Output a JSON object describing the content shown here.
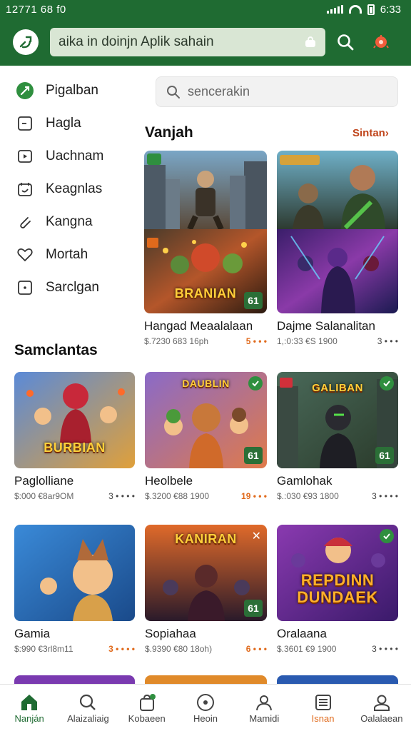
{
  "status": {
    "time": "12771 68 f0",
    "clock": "6:33"
  },
  "appbar": {
    "search_text": "aika in doinjn Aplik sahain"
  },
  "sidebar": {
    "items": [
      {
        "label": "Pigalban",
        "icon": "compass-icon"
      },
      {
        "label": "Hagla",
        "icon": "square-icon"
      },
      {
        "label": "Uachnam",
        "icon": "video-icon"
      },
      {
        "label": "Keagnlas",
        "icon": "calendar-icon"
      },
      {
        "label": "Kangna",
        "icon": "paperclip-icon"
      },
      {
        "label": "Mortah",
        "icon": "heart-icon"
      },
      {
        "label": "Sarclgan",
        "icon": "dot-square-icon"
      }
    ]
  },
  "content_search": {
    "placeholder": "sencerakin"
  },
  "featured": {
    "title": "Vanjah",
    "link": "Sintan›",
    "cards": [
      {
        "name": "Hangad Meaalalaan",
        "meta": "$.7230 683 16ph",
        "rating": "5 • • •",
        "badge": "61",
        "art_title": "BRANIAN"
      },
      {
        "name": "Dajme Salanalitan",
        "meta": "1,:0:33 €S 1900",
        "rating": "3 • • •",
        "badge": "",
        "art_title": ""
      }
    ]
  },
  "section2": {
    "title": "Samclantas",
    "cards": [
      {
        "name": "Paglolliane",
        "meta": "$:000 €8ar9OM",
        "rating": "3 • • • •",
        "badge": "",
        "art_title": "BURBIAN"
      },
      {
        "name": "Heolbele",
        "meta": "$.3200 €88 1900",
        "rating": "19 • • •",
        "badge": "61",
        "art_title": "DAUBLIN"
      },
      {
        "name": "Gamlohak",
        "meta": "$.:030 €93 1800",
        "rating": "3 • • • •",
        "badge": "61",
        "art_title": "GALIBAN"
      },
      {
        "name": "Gamia",
        "meta": "$:990 €3rl8m11",
        "rating": "3 • • • •",
        "badge": "",
        "art_title": ""
      },
      {
        "name": "Sopiahaa",
        "meta": "$.9390 €80 18oh)",
        "rating": "6 • • •",
        "badge": "61",
        "art_title": "KANIRAN"
      },
      {
        "name": "Oralaana",
        "meta": "$.3601 €9 1900",
        "rating": "3 • • • •",
        "badge": "",
        "art_title": "REPDINN DUNDAEK"
      }
    ]
  },
  "bottomnav": [
    {
      "label": "Nanján",
      "icon": "home-icon"
    },
    {
      "label": "Alaizaliaig",
      "icon": "search-icon"
    },
    {
      "label": "Kobaeen",
      "icon": "bag-icon"
    },
    {
      "label": "Heoin",
      "icon": "music-icon"
    },
    {
      "label": "Mamidi",
      "icon": "person-icon"
    },
    {
      "label": "Isnan",
      "icon": "list-icon"
    },
    {
      "label": "Oalalaean",
      "icon": "account-icon"
    }
  ],
  "colors": {
    "brand": "#1f6b32",
    "accent": "#e06a1c",
    "link": "#c0451b"
  }
}
